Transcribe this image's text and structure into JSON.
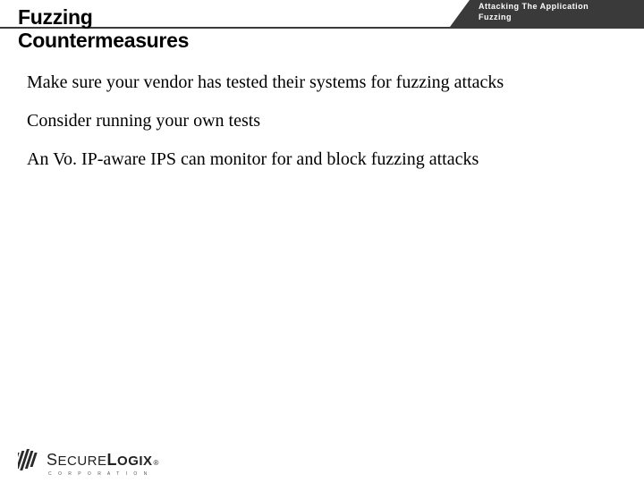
{
  "header": {
    "line1": "Attacking The Application",
    "line2": "Fuzzing"
  },
  "title": {
    "line1": "Fuzzing",
    "line2": "Countermeasures"
  },
  "bullets": [
    "Make sure your vendor has tested their systems for fuzzing attacks",
    "Consider running your own tests",
    "An Vo. IP-aware IPS can monitor for and block fuzzing attacks"
  ],
  "logo": {
    "part1": "S",
    "part2": "ECURE",
    "part3": "L",
    "part4": "OGIX",
    "reg": "®",
    "sub": "C O R P O R A T I O N"
  }
}
